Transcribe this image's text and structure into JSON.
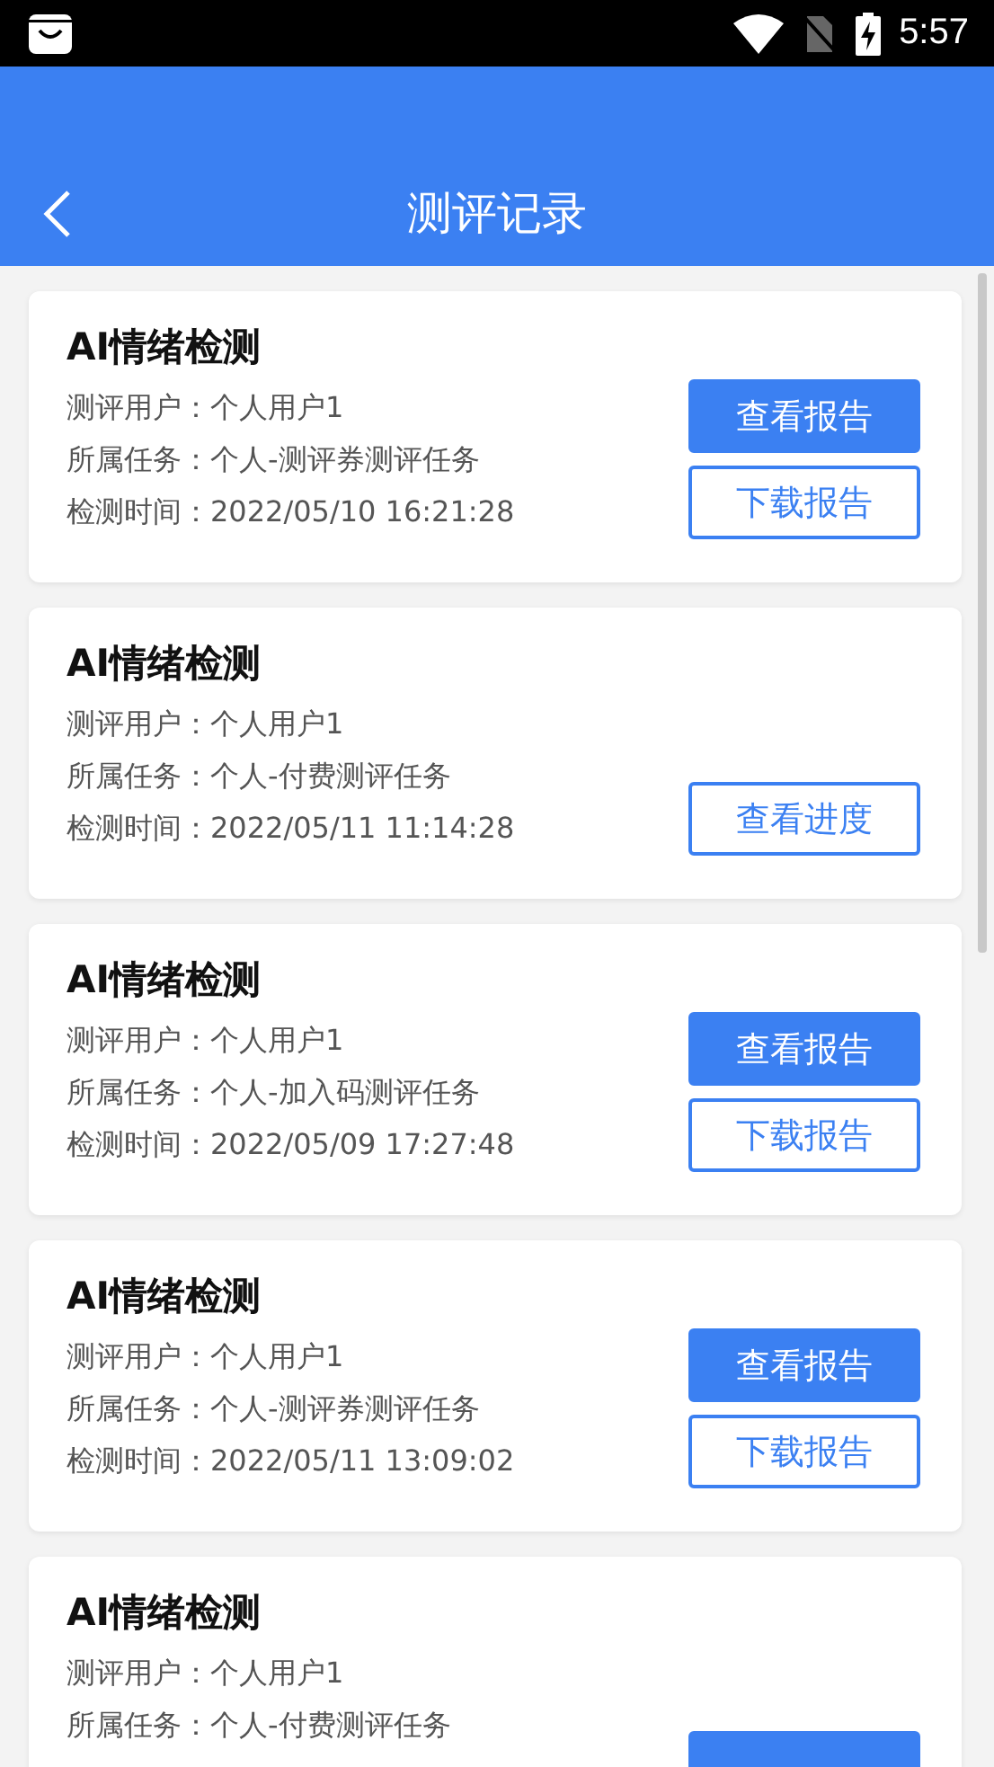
{
  "status_bar": {
    "time": "5:57"
  },
  "header": {
    "title": "测评记录"
  },
  "records": [
    {
      "title": "AI情绪检测",
      "fields": [
        {
          "label": "测评用户：",
          "value": "个人用户1"
        },
        {
          "label": "所属任务：",
          "value": "个人-测评券测评任务"
        },
        {
          "label": "检测时间：",
          "value": "2022/05/10 16:21:28"
        }
      ],
      "buttons": [
        {
          "label": "查看报告",
          "kind": "primary"
        },
        {
          "label": "下载报告",
          "kind": "outline"
        }
      ]
    },
    {
      "title": "AI情绪检测",
      "fields": [
        {
          "label": "测评用户：",
          "value": "个人用户1"
        },
        {
          "label": "所属任务：",
          "value": "个人-付费测评任务"
        },
        {
          "label": "检测时间：",
          "value": "2022/05/11 11:14:28"
        }
      ],
      "buttons": [
        {
          "label": "查看进度",
          "kind": "outline"
        }
      ]
    },
    {
      "title": "AI情绪检测",
      "fields": [
        {
          "label": "测评用户：",
          "value": "个人用户1"
        },
        {
          "label": "所属任务：",
          "value": "个人-加入码测评任务"
        },
        {
          "label": "检测时间：",
          "value": "2022/05/09 17:27:48"
        }
      ],
      "buttons": [
        {
          "label": "查看报告",
          "kind": "primary"
        },
        {
          "label": "下载报告",
          "kind": "outline"
        }
      ]
    },
    {
      "title": "AI情绪检测",
      "fields": [
        {
          "label": "测评用户：",
          "value": "个人用户1"
        },
        {
          "label": "所属任务：",
          "value": "个人-测评券测评任务"
        },
        {
          "label": "检测时间：",
          "value": "2022/05/11 13:09:02"
        }
      ],
      "buttons": [
        {
          "label": "查看报告",
          "kind": "primary"
        },
        {
          "label": "下载报告",
          "kind": "outline"
        }
      ]
    },
    {
      "title": "AI情绪检测",
      "fields": [
        {
          "label": "测评用户：",
          "value": "个人用户1"
        },
        {
          "label": "所属任务：",
          "value": "个人-付费测评任务"
        }
      ],
      "buttons": [
        {
          "kind": "primary"
        }
      ]
    }
  ]
}
